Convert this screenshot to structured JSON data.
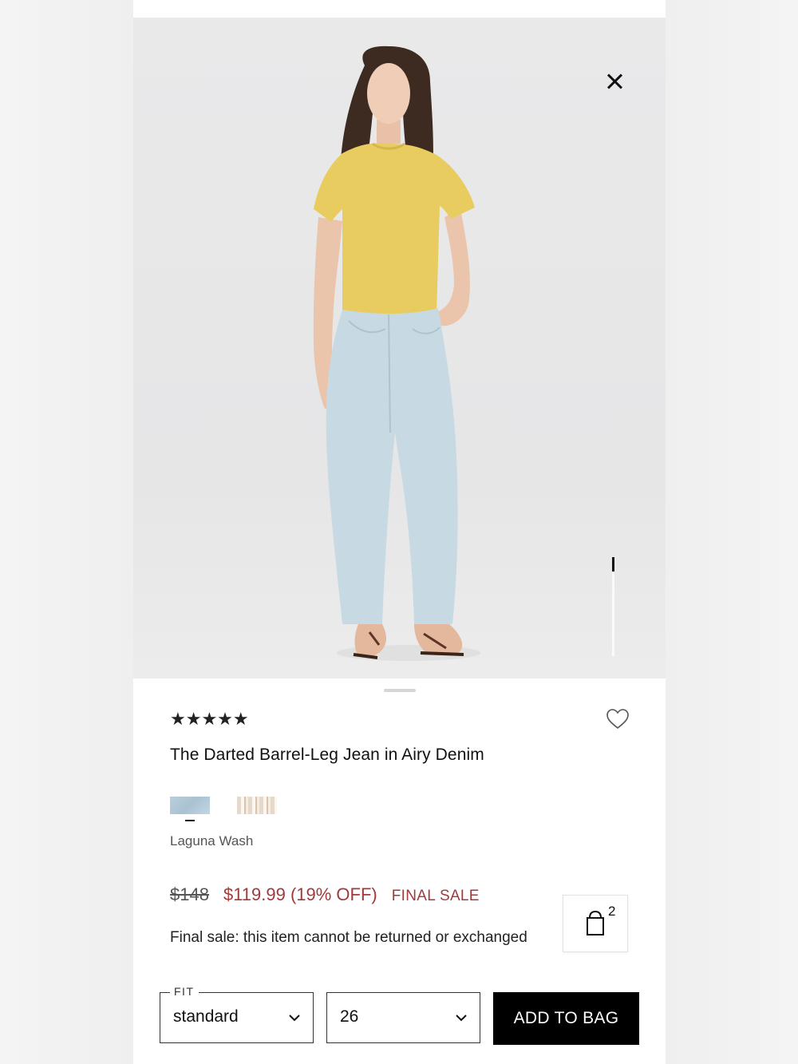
{
  "product": {
    "rating_stars": "★★★★★",
    "title": "The Darted Barrel-Leg Jean in Airy Denim",
    "color_name": "Laguna Wash",
    "original_price": "$148",
    "sale_price": "$119.99 (19% OFF)",
    "sale_tag": "FINAL SALE",
    "final_note": "Final sale: this item cannot be returned or exchanged"
  },
  "bag": {
    "count": "2"
  },
  "controls": {
    "fit_label": "FIT",
    "fit_value": "standard",
    "size_value": "26",
    "add_to_bag_label": "ADD TO BAG"
  },
  "colors": {
    "sale": "#a23a3a",
    "button": "#000000"
  }
}
